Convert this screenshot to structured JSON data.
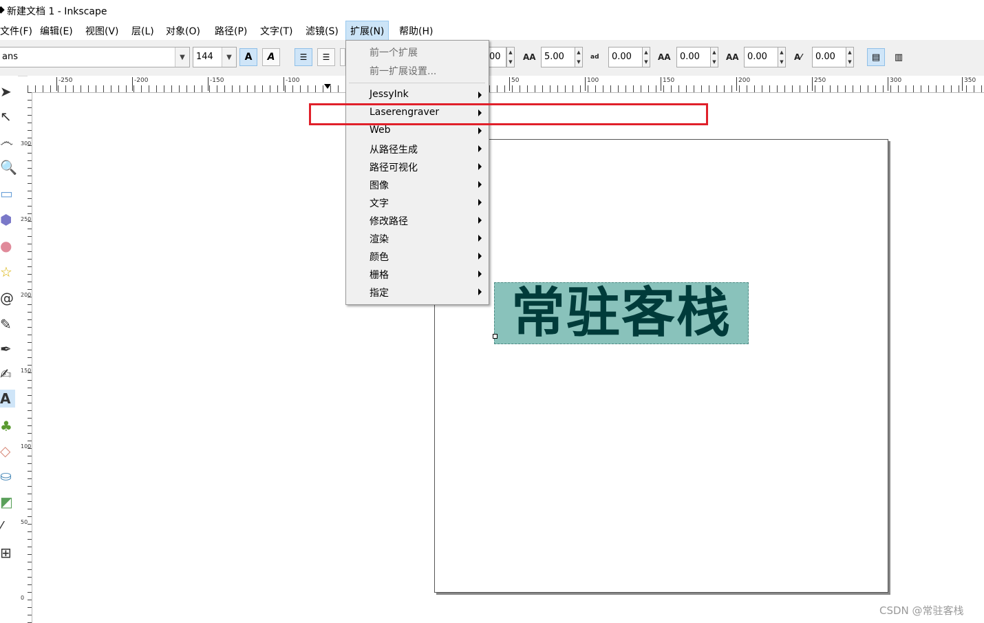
{
  "window": {
    "title": "新建文档 1 - Inkscape"
  },
  "menubar": {
    "items": [
      {
        "label": "文件(F)"
      },
      {
        "label": "编辑(E)"
      },
      {
        "label": "视图(V)"
      },
      {
        "label": "层(L)"
      },
      {
        "label": "对象(O)"
      },
      {
        "label": "路径(P)"
      },
      {
        "label": "文字(T)"
      },
      {
        "label": "滤镜(S)"
      },
      {
        "label": "扩展(N)"
      },
      {
        "label": "帮助(H)"
      }
    ]
  },
  "toolbar": {
    "font_family": "ans",
    "font_size": "144",
    "bold_label": "A",
    "italic_label": "A",
    "spacing_value_partial": "00",
    "line_spacing": "5.00",
    "letter_spacing": "0.00",
    "word_spacing": "0.00",
    "kerning": "0.00",
    "rotation": "0.00"
  },
  "ruler": {
    "h_labels": [
      "-250",
      "-200",
      "-150",
      "-100",
      "50",
      "100",
      "150",
      "200",
      "250",
      "300",
      "350"
    ],
    "v_labels": [
      "300",
      "250",
      "200",
      "150",
      "100",
      "50",
      "0"
    ]
  },
  "extensions_menu": {
    "disabled": [
      {
        "label": "前一个扩展"
      },
      {
        "label": "前一扩展设置..."
      }
    ],
    "items": [
      {
        "label": "JessyInk"
      },
      {
        "label": "Laserengraver"
      },
      {
        "label": "Web"
      },
      {
        "label": "从路径生成"
      },
      {
        "label": "路径可视化"
      },
      {
        "label": "图像"
      },
      {
        "label": "文字"
      },
      {
        "label": "修改路径"
      },
      {
        "label": "渲染"
      },
      {
        "label": "颜色"
      },
      {
        "label": "栅格"
      },
      {
        "label": "指定"
      }
    ]
  },
  "canvas": {
    "text_object": "常驻客栈"
  },
  "highlight_color": "#e0202a",
  "watermark": "CSDN @常驻客栈"
}
